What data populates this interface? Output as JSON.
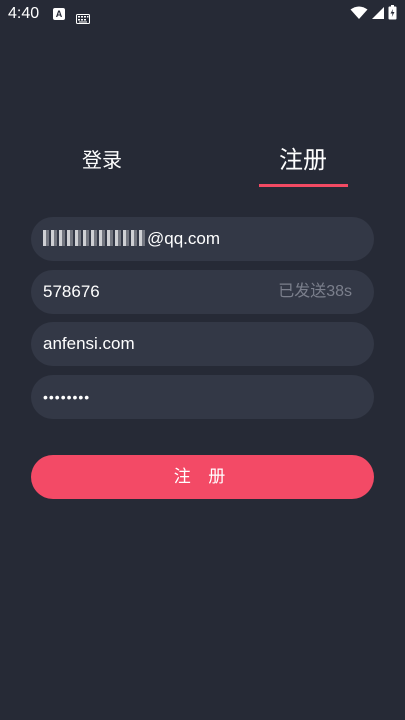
{
  "status_bar": {
    "time": "4:40",
    "notification_icon_label": "A",
    "icons": [
      "a-notification-icon",
      "keyboard-icon",
      "wifi-icon",
      "signal-icon",
      "battery-icon"
    ]
  },
  "tabs": {
    "login_label": "登录",
    "register_label": "注册",
    "active": "register"
  },
  "form": {
    "email_suffix": "@qq.com",
    "verification_code": "578676",
    "code_status": "已发送38s",
    "domain": "anfensi.com",
    "password_masked": "••••••••"
  },
  "button": {
    "submit_label": "注 册"
  },
  "colors": {
    "background": "#262a36",
    "field_bg": "#333846",
    "accent": "#f34a66",
    "muted_text": "#7b7f8c"
  }
}
